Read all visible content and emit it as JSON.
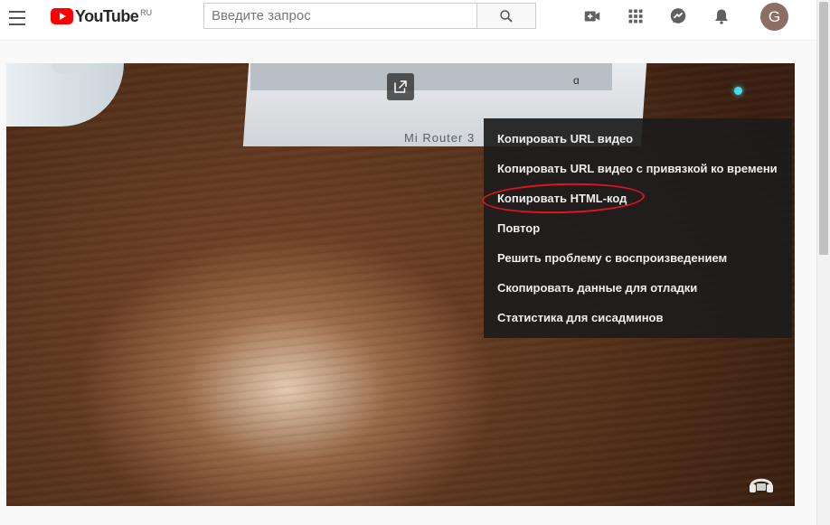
{
  "header": {
    "logo_text": "YouTube",
    "logo_region": "RU",
    "search_placeholder": "Введите запрос",
    "avatar_letter": "G"
  },
  "player": {
    "box_label": "Mi Router 3",
    "box_mark": "ɑ"
  },
  "context_menu": {
    "items": [
      "Копировать URL видео",
      "Копировать URL видео с привязкой ко времени",
      "Копировать HTML-код",
      "Повтор",
      "Решить проблему с воспроизведением",
      "Скопировать данные для отладки",
      "Статистика для сисадминов"
    ],
    "highlighted_item": "Копировать HTML-код",
    "highlight_color": "#e0141e"
  },
  "colors": {
    "brand_red": "#ff0000",
    "avatar_bg": "#8d6e63",
    "menu_bg": "#1c1c1c"
  }
}
